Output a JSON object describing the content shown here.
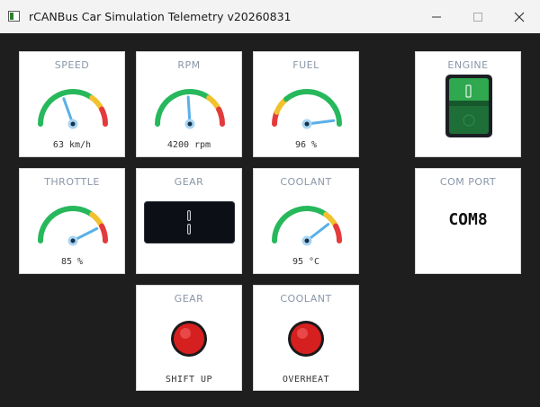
{
  "window": {
    "title": "rCANBus Car Simulation Telemetry v20260831",
    "controls": [
      "minimize",
      "maximize",
      "close"
    ]
  },
  "colors": {
    "background": "#1e1e1e",
    "panel": "#ffffff",
    "label": "#8a97a8",
    "gauge_green": "#27b85c",
    "gauge_yellow": "#f2c12e",
    "gauge_red": "#e33b3b",
    "needle": "#5ab0e6",
    "switch_green": "#2fa84f",
    "led_red": "#e02020"
  },
  "panels": {
    "speed": {
      "label": "SPEED",
      "value": "63 km/h",
      "level": 0.39,
      "zones": [
        "green",
        "yellow",
        "red"
      ]
    },
    "rpm": {
      "label": "RPM",
      "value": "4200 rpm",
      "level": 0.48,
      "zones": [
        "green",
        "yellow",
        "red"
      ]
    },
    "fuel": {
      "label": "FUEL",
      "value": "96 %",
      "level": 0.96,
      "zones": [
        "red",
        "yellow",
        "green"
      ]
    },
    "engine": {
      "label": "ENGINE",
      "state": "on",
      "switch_mark": "I"
    },
    "throttle": {
      "label": "THROTTLE",
      "value": "85 %",
      "level": 0.85,
      "zones": [
        "green",
        "yellow",
        "red"
      ]
    },
    "gear": {
      "label": "GEAR",
      "display": "1"
    },
    "coolant": {
      "label": "COOLANT",
      "value": "95 °C",
      "level": 0.79,
      "zones": [
        "green",
        "yellow",
        "red"
      ]
    },
    "com_port": {
      "label": "COM PORT",
      "value": "COM8"
    },
    "gear_shift": {
      "label": "GEAR",
      "indicator": "SHIFT UP",
      "led": "red"
    },
    "coolant_warn": {
      "label": "COOLANT",
      "indicator": "OVERHEAT",
      "led": "red"
    }
  }
}
